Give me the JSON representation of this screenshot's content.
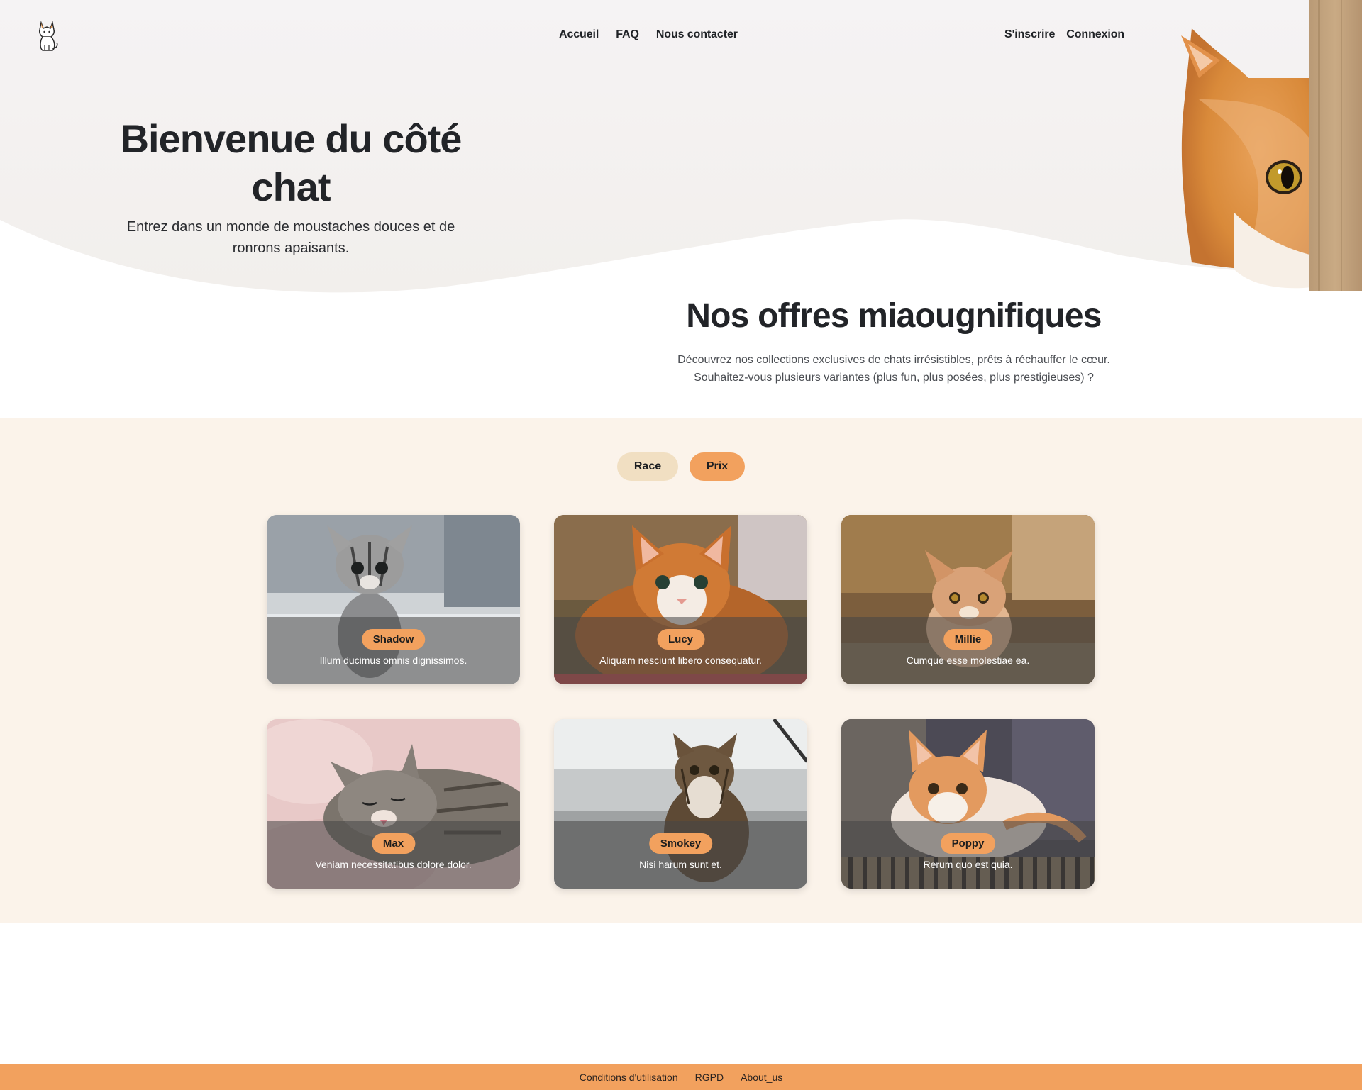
{
  "header": {
    "logo_icon": "cat-sitting-icon",
    "nav": [
      {
        "label": "Accueil"
      },
      {
        "label": "FAQ"
      },
      {
        "label": "Nous contacter"
      }
    ],
    "auth": {
      "signup_label": "S'inscrire",
      "login_label": "Connexion"
    }
  },
  "hero": {
    "title": "Bienvenue du côté chat",
    "subtitle": "Entrez dans un monde de moustaches douces et de ronrons apaisants."
  },
  "offers": {
    "title": "Nos offres miaougnifiques",
    "description_line1": "Découvrez nos collections exclusives de chats irrésistibles, prêts à réchauffer le cœur.",
    "description_line2": "Souhaitez-vous plusieurs variantes (plus fun, plus posées, plus prestigieuses) ?"
  },
  "filters": {
    "race_label": "Race",
    "prix_label": "Prix"
  },
  "cats": [
    {
      "name": "Shadow",
      "description": "Illum ducimus omnis dignissimos."
    },
    {
      "name": "Lucy",
      "description": "Aliquam nesciunt libero consequatur."
    },
    {
      "name": "Millie",
      "description": "Cumque esse molestiae ea."
    },
    {
      "name": "Max",
      "description": "Veniam necessitatibus dolore dolor."
    },
    {
      "name": "Smokey",
      "description": "Nisi harum sunt et."
    },
    {
      "name": "Poppy",
      "description": "Rerum quo est quia."
    }
  ],
  "footer": {
    "links": [
      {
        "label": "Conditions d'utilisation"
      },
      {
        "label": "RGPD"
      },
      {
        "label": "About_us"
      }
    ]
  },
  "colors": {
    "accent": "#f2a15e",
    "catalog_bg": "#fbf3ea",
    "hero_bg": "#f4f2f1",
    "race_filter_bg": "#f1dfc2"
  }
}
